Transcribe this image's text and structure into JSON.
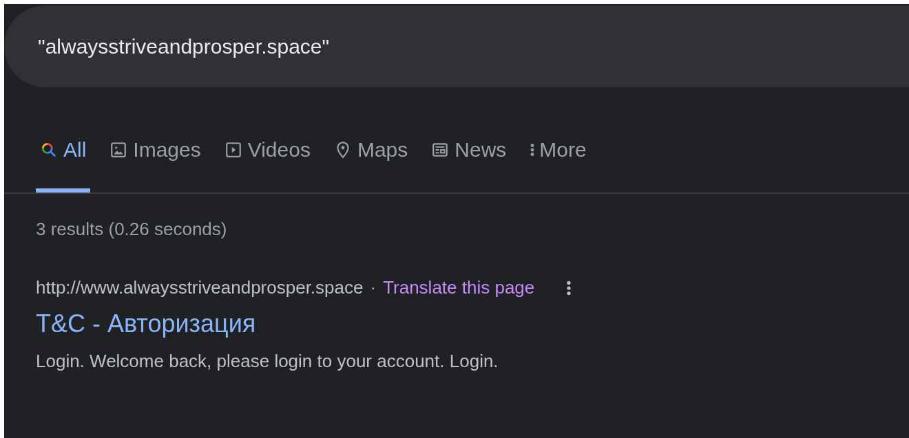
{
  "search": {
    "value": "\"alwaysstriveandprosper.space\""
  },
  "tabs": [
    {
      "kind": "all",
      "label": "All",
      "selected": true
    },
    {
      "kind": "images",
      "label": "Images",
      "selected": false
    },
    {
      "kind": "videos",
      "label": "Videos",
      "selected": false
    },
    {
      "kind": "maps",
      "label": "Maps",
      "selected": false
    },
    {
      "kind": "news",
      "label": "News",
      "selected": false
    },
    {
      "kind": "more",
      "label": "More",
      "selected": false
    }
  ],
  "result_stats": "3 results (0.26 seconds)",
  "results": [
    {
      "url": "http://www.alwaysstriveandprosper.space",
      "separator": "·",
      "translate": "Translate this page",
      "title": "T&C - Авторизация",
      "snippet": "Login. Welcome back, please login to your account. Login."
    }
  ]
}
